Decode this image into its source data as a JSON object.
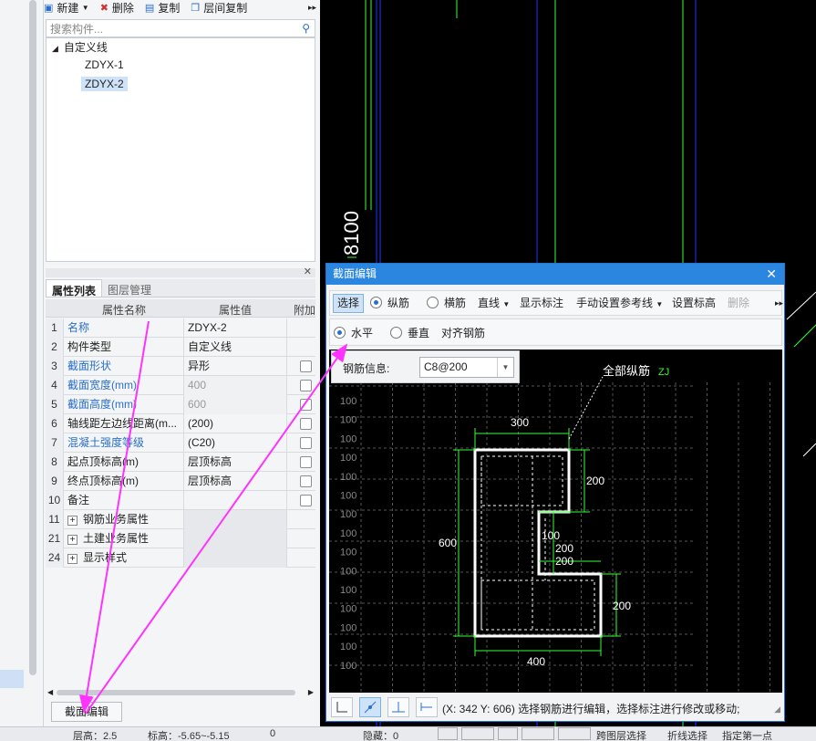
{
  "toolbar": {
    "new_label": "新建",
    "delete_label": "删除",
    "copy_label": "复制",
    "floor_copy_label": "层间复制",
    "more": "▸▸"
  },
  "search": {
    "placeholder": "搜索构件..."
  },
  "tree": {
    "root": "自定义线",
    "items": [
      "ZDYX-1",
      "ZDYX-2"
    ],
    "selected": "ZDYX-2"
  },
  "props": {
    "tabs": [
      "属性列表",
      "图层管理"
    ],
    "headers": {
      "name": "属性名称",
      "value": "属性值",
      "extra": "附加"
    },
    "rows": [
      {
        "num": "1",
        "name": "名称",
        "value": "ZDYX-2",
        "blue": true,
        "check": false,
        "gray": false
      },
      {
        "num": "2",
        "name": "构件类型",
        "value": "自定义线",
        "blue": false,
        "check": false,
        "gray": false
      },
      {
        "num": "3",
        "name": "截面形状",
        "value": "异形",
        "blue": true,
        "check": true,
        "gray": false
      },
      {
        "num": "4",
        "name": "截面宽度(mm)",
        "value": "400",
        "blue": true,
        "check": true,
        "gray": true
      },
      {
        "num": "5",
        "name": "截面高度(mm)",
        "value": "600",
        "blue": true,
        "check": true,
        "gray": true
      },
      {
        "num": "6",
        "name": "轴线距左边线距离(m...",
        "value": "(200)",
        "blue": false,
        "check": true,
        "gray": false
      },
      {
        "num": "7",
        "name": "混凝土强度等级",
        "value": "(C20)",
        "blue": true,
        "check": true,
        "gray": false
      },
      {
        "num": "8",
        "name": "起点顶标高(m)",
        "value": "层顶标高",
        "blue": false,
        "check": true,
        "gray": false
      },
      {
        "num": "9",
        "name": "终点顶标高(m)",
        "value": "层顶标高",
        "blue": false,
        "check": true,
        "gray": false
      },
      {
        "num": "10",
        "name": "备注",
        "value": "",
        "blue": false,
        "check": true,
        "gray": false
      },
      {
        "num": "11",
        "name": "钢筋业务属性",
        "value": "",
        "group": true
      },
      {
        "num": "21",
        "name": "土建业务属性",
        "value": "",
        "group": true
      },
      {
        "num": "24",
        "name": "显示样式",
        "value": "",
        "group": true
      }
    ]
  },
  "edit_button": "截面编辑",
  "cad": {
    "dimension_label": "8100"
  },
  "dialog": {
    "title": "截面编辑",
    "toolbar1": {
      "select": "选择",
      "longitudinal": "纵筋",
      "transverse": "横筋",
      "line": "直线",
      "show_dim": "显示标注",
      "manual_ref": "手动设置参考线",
      "set_elev": "设置标高",
      "delete": "删除"
    },
    "toolbar2": {
      "horizontal": "水平",
      "vertical": "垂直",
      "align": "对齐钢筋"
    },
    "rebar_info_label": "钢筋信息:",
    "rebar_info_value": "C8@200",
    "annotation": "全部纵筋",
    "annotation_code": "ZJ",
    "grid_label": "100",
    "dims": [
      "300",
      "200",
      "600",
      "100",
      "200",
      "200",
      "200",
      "400"
    ],
    "status": "(X: 342 Y: 606) 选择钢筋进行编辑，选择标注进行修改或移动;"
  },
  "statusbar": {
    "floor_height": "层高：2.5",
    "elevation": "标高：-5.65~-5.15",
    "zero": "0",
    "hidden": "隐藏：0",
    "cross_floor": "跨图层选择",
    "polyline": "折线选择",
    "assign": "指定第一点"
  },
  "colors": {
    "accent": "#2b86e0",
    "arrow": "#ff33ff",
    "cad_line": "#33ff33",
    "grid": "#555555"
  }
}
